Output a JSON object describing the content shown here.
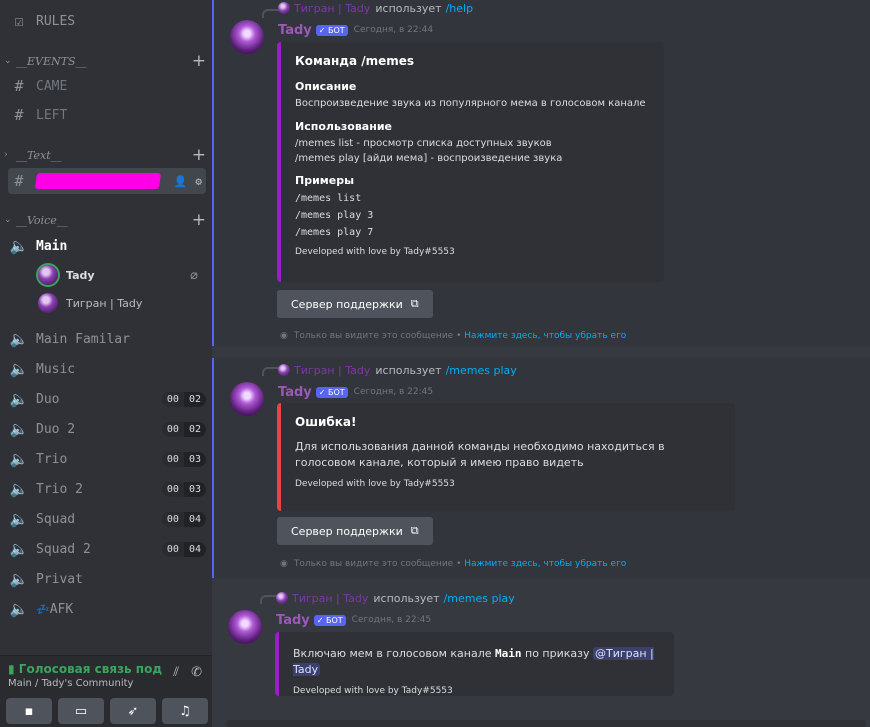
{
  "sidebar": {
    "rules_channel": "RULES",
    "cat_events": "__EVENTS__",
    "came_channel": "CAME",
    "left_channel": "LEFT",
    "cat_text": "__Text__",
    "cat_voice": "__Voice__",
    "voice_channels": [
      {
        "name": "Main"
      },
      {
        "name": "Main Familar"
      },
      {
        "name": "Music"
      },
      {
        "name": "Duo",
        "count": "00",
        "limit": "02"
      },
      {
        "name": "Duo 2",
        "count": "00",
        "limit": "02"
      },
      {
        "name": "Trio",
        "count": "00",
        "limit": "03"
      },
      {
        "name": "Trio 2",
        "count": "00",
        "limit": "03"
      },
      {
        "name": "Squad",
        "count": "00",
        "limit": "04"
      },
      {
        "name": "Squad 2",
        "count": "00",
        "limit": "04"
      },
      {
        "name": "Privat"
      },
      {
        "name": "AFK",
        "prefix": "💤"
      }
    ],
    "voice_users": [
      {
        "name": "Tady"
      },
      {
        "name": "Тигран | Tady"
      }
    ]
  },
  "voice_panel": {
    "status": "Голосовая связь под",
    "subtitle": "Main / Tady's Community"
  },
  "messages": [
    {
      "reply_user": "Тигран | Tady",
      "reply_uses": "использует",
      "reply_cmd": "/help",
      "bot_name": "Tady",
      "badge": "✓ БОТ",
      "time": "Сегодня, в 22:44",
      "embed_title": "Команда /memes",
      "f1_name": "Описание",
      "f1_value": "Воспроизведение звука из популярного мема в голосовом канале",
      "f2_name": "Использование",
      "f2_line1": "/memes list - просмотр списка доступных звуков",
      "f2_line2": "/memes play [айди мема] - воспроизведение звука",
      "f3_name": "Примеры",
      "ex1": "/memes list",
      "ex2": "/memes play 3",
      "ex3": "/memes play 7",
      "footer": "Developed with love by Tady#5553",
      "button": "Сервер поддержки",
      "note": "Только вы видите это сообщение •",
      "note_link": "Нажмите здесь, чтобы убрать его"
    },
    {
      "reply_user": "Тигран | Tady",
      "reply_uses": "использует",
      "reply_cmd": "/memes play",
      "bot_name": "Tady",
      "badge": "✓ БОТ",
      "time": "Сегодня, в 22:45",
      "embed_title": "Ошибка!",
      "desc": "Для использования данной команды необходимо находиться в голосовом канале, который я имею право видеть",
      "footer": "Developed with love by Tady#5553",
      "button": "Сервер поддержки",
      "note": "Только вы видите это сообщение •",
      "note_link": "Нажмите здесь, чтобы убрать его"
    },
    {
      "reply_user": "Тигран | Tady",
      "reply_uses": "использует",
      "reply_cmd": "/memes play",
      "bot_name": "Tady",
      "badge": "✓ БОТ",
      "time": "Сегодня, в 22:45",
      "desc_pre": "Включаю мем в голосовом канале",
      "desc_channel": "Main",
      "desc_mid": "по приказу",
      "desc_mention": "@Тигран | Tady",
      "footer": "Developed with love by Tady#5553"
    }
  ],
  "colors": {
    "accent": "#5865f2",
    "embed_purple": "#9b1fc9",
    "embed_red": "#ed4245",
    "voice_green": "#3ba55d"
  },
  "icons": [
    "hash-icon",
    "speaker-icon",
    "plus-icon",
    "gear-icon",
    "add-member-icon",
    "mute-icon",
    "external-link-icon",
    "eye-icon",
    "camera-icon",
    "screen-share-icon",
    "rocket-icon",
    "activity-icon",
    "disconnect-icon",
    "noise-icon",
    "signal-icon"
  ]
}
